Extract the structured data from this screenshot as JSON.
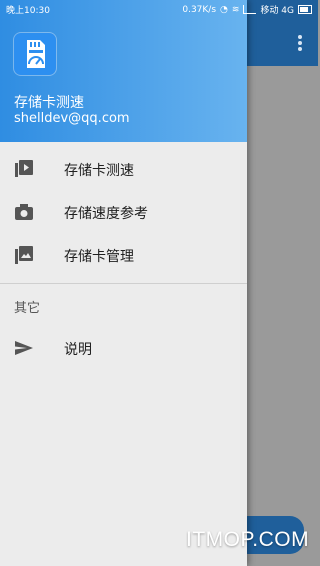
{
  "status_bar": {
    "time": "晚上10:30",
    "speed": "0.37K/s",
    "carrier": "移动 4G"
  },
  "drawer": {
    "header": {
      "app_name": "存储卡测速",
      "email": "shelldev@qq.com"
    },
    "items": [
      {
        "label": "存储卡测速",
        "icon": "video-library-icon"
      },
      {
        "label": "存储速度参考",
        "icon": "camera-icon"
      },
      {
        "label": "存储卡管理",
        "icon": "photo-library-icon"
      }
    ],
    "section_title": "其它",
    "other_items": [
      {
        "label": "说明",
        "icon": "send-icon"
      }
    ]
  },
  "watermark": "ITMOP.COM",
  "colors": {
    "app_bar": "#1f5f9b",
    "header_start": "#2f8de2",
    "header_end": "#68b3ef",
    "drawer_bg": "#ececec"
  }
}
